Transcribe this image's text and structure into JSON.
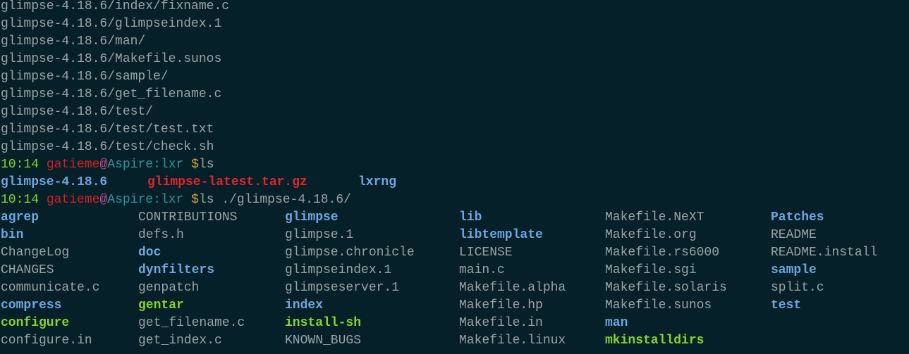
{
  "colors": {
    "background": "#062029",
    "text": "#9aa3a6",
    "directory": "#6ea6de",
    "executable": "#84d62c",
    "archive": "#e2242b",
    "prompt_time": "#84d62c",
    "prompt_user": "#d01f24",
    "prompt_at": "#c94b87",
    "prompt_host": "#2d94a3",
    "prompt_dollar": "#d8a531"
  },
  "tar_output": [
    "glimpse-4.18.6/index/fixname.c",
    "glimpse-4.18.6/glimpseindex.1",
    "glimpse-4.18.6/man/",
    "glimpse-4.18.6/Makefile.sunos",
    "glimpse-4.18.6/sample/",
    "glimpse-4.18.6/get_filename.c",
    "glimpse-4.18.6/test/",
    "glimpse-4.18.6/test/test.txt",
    "glimpse-4.18.6/test/check.sh"
  ],
  "prompt1": {
    "time": "10:14",
    "user": "gatieme",
    "at": "@",
    "host": "Aspire",
    "sep": ":",
    "path": "lxr",
    "dollar": "$",
    "command": "ls"
  },
  "ls_output": [
    {
      "name": "glimpse-4.18.6",
      "type": "directory"
    },
    {
      "name": "glimpse-latest.tar.gz",
      "type": "archive"
    },
    {
      "name": "lxrng",
      "type": "directory"
    }
  ],
  "prompt2": {
    "time": "10:14",
    "user": "gatieme",
    "at": "@",
    "host": "Aspire",
    "sep": ":",
    "path": "lxr",
    "dollar": "$",
    "command": "ls ./glimpse-4.18.6/"
  },
  "listing_columns": [
    [
      {
        "name": "agrep",
        "type": "directory"
      },
      {
        "name": "bin",
        "type": "directory"
      },
      {
        "name": "ChangeLog",
        "type": "file"
      },
      {
        "name": "CHANGES",
        "type": "file"
      },
      {
        "name": "communicate.c",
        "type": "file"
      },
      {
        "name": "compress",
        "type": "directory"
      },
      {
        "name": "configure",
        "type": "executable"
      },
      {
        "name": "configure.in",
        "type": "file"
      }
    ],
    [
      {
        "name": "CONTRIBUTIONS",
        "type": "file"
      },
      {
        "name": "defs.h",
        "type": "file"
      },
      {
        "name": "doc",
        "type": "directory"
      },
      {
        "name": "dynfilters",
        "type": "directory"
      },
      {
        "name": "genpatch",
        "type": "file"
      },
      {
        "name": "gentar",
        "type": "executable"
      },
      {
        "name": "get_filename.c",
        "type": "file"
      },
      {
        "name": "get_index.c",
        "type": "file"
      }
    ],
    [
      {
        "name": "glimpse",
        "type": "directory"
      },
      {
        "name": "glimpse.1",
        "type": "file"
      },
      {
        "name": "glimpse.chronicle",
        "type": "file"
      },
      {
        "name": "glimpseindex.1",
        "type": "file"
      },
      {
        "name": "glimpseserver.1",
        "type": "file"
      },
      {
        "name": "index",
        "type": "directory"
      },
      {
        "name": "install-sh",
        "type": "executable"
      },
      {
        "name": "KNOWN_BUGS",
        "type": "file"
      }
    ],
    [
      {
        "name": "lib",
        "type": "directory"
      },
      {
        "name": "libtemplate",
        "type": "directory"
      },
      {
        "name": "LICENSE",
        "type": "file"
      },
      {
        "name": "main.c",
        "type": "file"
      },
      {
        "name": "Makefile.alpha",
        "type": "file"
      },
      {
        "name": "Makefile.hp",
        "type": "file"
      },
      {
        "name": "Makefile.in",
        "type": "file"
      },
      {
        "name": "Makefile.linux",
        "type": "file"
      }
    ],
    [
      {
        "name": "Makefile.NeXT",
        "type": "file"
      },
      {
        "name": "Makefile.org",
        "type": "file"
      },
      {
        "name": "Makefile.rs6000",
        "type": "file"
      },
      {
        "name": "Makefile.sgi",
        "type": "file"
      },
      {
        "name": "Makefile.solaris",
        "type": "file"
      },
      {
        "name": "Makefile.sunos",
        "type": "file"
      },
      {
        "name": "man",
        "type": "directory"
      },
      {
        "name": "mkinstalldirs",
        "type": "executable"
      }
    ],
    [
      {
        "name": "Patches",
        "type": "directory"
      },
      {
        "name": "README",
        "type": "file"
      },
      {
        "name": "README.install",
        "type": "file"
      },
      {
        "name": "sample",
        "type": "directory"
      },
      {
        "name": "split.c",
        "type": "file"
      },
      {
        "name": "test",
        "type": "directory"
      }
    ]
  ]
}
